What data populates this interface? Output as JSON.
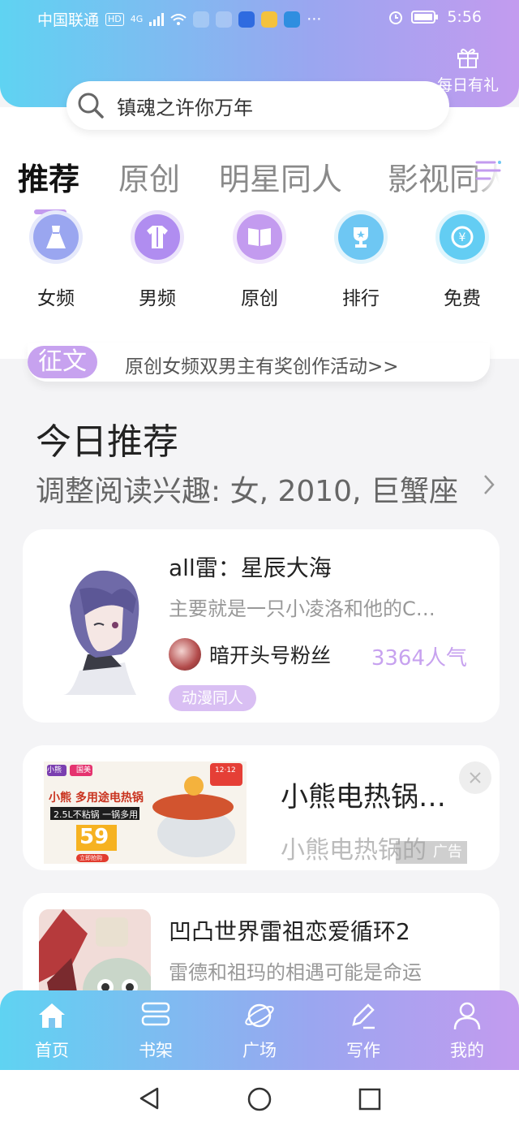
{
  "status_bar": {
    "carrier": "中国联通",
    "hd": "HD",
    "net": "4G",
    "time": "5:56"
  },
  "gift": {
    "label": "每日有礼",
    "icon": "gift-icon"
  },
  "search": {
    "text": "镇魂之许你万年",
    "icon": "search-icon"
  },
  "tabs": [
    "推荐",
    "原创",
    "明星同人",
    "影视同人"
  ],
  "categories": [
    {
      "label": "女频",
      "icon": "dress-icon",
      "color": "#9aa6f0"
    },
    {
      "label": "男频",
      "icon": "shirt-icon",
      "color": "#b08df0"
    },
    {
      "label": "原创",
      "icon": "book-icon",
      "color": "#c39bef"
    },
    {
      "label": "排行",
      "icon": "trophy-icon",
      "color": "#6ec7f3"
    },
    {
      "label": "免费",
      "icon": "coin-icon",
      "color": "#63cdf3"
    }
  ],
  "notice": {
    "tag": "征文",
    "text": "原创女频双男主有奖创作活动>>"
  },
  "section": {
    "title": "今日推荐",
    "subtitle": "调整阅读兴趣: 女, 2010, 巨蟹座"
  },
  "books": [
    {
      "title": "all雷：星辰大海",
      "desc": "主要就是一只小凌洛和他的C…",
      "author": "暗开头号粉丝",
      "popularity": "3364人气",
      "genre": "动漫同人"
    },
    {
      "title": "凹凸世界雷祖恋爱循环2",
      "desc": "雷德和祖玛的相遇可能是命运"
    }
  ],
  "ad": {
    "title": "小熊电热锅…",
    "desc": "小熊电热锅的",
    "label": "广告",
    "image_text": {
      "brand1": "小熊",
      "brand2": "国美",
      "headline": "小熊 多用途电热锅",
      "sub": "2.5L不粘锅 一锅多用",
      "price": "59",
      "badge": "12·12",
      "cta": "立即抢购"
    }
  },
  "bottom_nav": [
    {
      "label": "首页",
      "icon": "home-icon"
    },
    {
      "label": "书架",
      "icon": "bookshelf-icon"
    },
    {
      "label": "广场",
      "icon": "planet-icon"
    },
    {
      "label": "写作",
      "icon": "pen-icon"
    },
    {
      "label": "我的",
      "icon": "user-icon"
    }
  ]
}
